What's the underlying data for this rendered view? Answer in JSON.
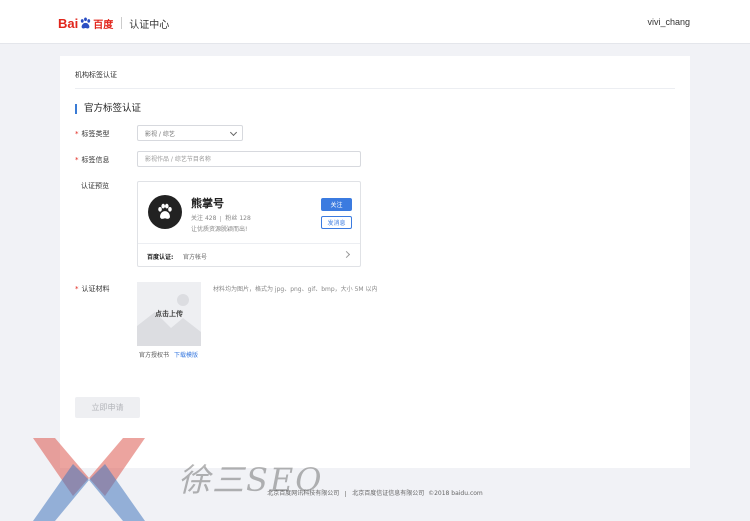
{
  "header": {
    "logo_text_latin": "Bai",
    "logo_text_cn": "百度",
    "product_title": "认证中心",
    "username": "vivi_chang"
  },
  "card": {
    "breadcrumb": "机构标签认证",
    "section_title": "官方标签认证"
  },
  "form": {
    "tag_type_label": "标签类型",
    "tag_type_value": "影视 / 综艺",
    "tag_info_label": "标签信息",
    "tag_info_placeholder": "影视作品 / 综艺节目名称",
    "preview_label": "认证预览",
    "material_label": "认证材料"
  },
  "preview": {
    "name": "熊掌号",
    "following_label": "关注",
    "following_count": "428",
    "fans_label": "粉丝",
    "fans_count": "128",
    "description": "让优质资源脱颖而出!",
    "follow_button": "关注",
    "message_button": "发消息",
    "cert_label": "百度认证:",
    "cert_value": "官方帐号"
  },
  "upload": {
    "label": "点击上传",
    "hint": "材料均为图片，格式为 jpg、png、gif、bmp，大小 5M 以内",
    "auth_text": "官方授权书",
    "download_link": "下载模版"
  },
  "submit_label": "立即申请",
  "footer": {
    "company1": "北京百度网讯科技有限公司",
    "company2": "北京百度信证信息有限公司",
    "copyright": "©2018 baidu.com"
  },
  "watermark": {
    "text": "徐三SEO"
  },
  "colors": {
    "brand_red": "#e1251b",
    "accent_blue": "#3b7be0",
    "background": "#f1f2f6"
  }
}
